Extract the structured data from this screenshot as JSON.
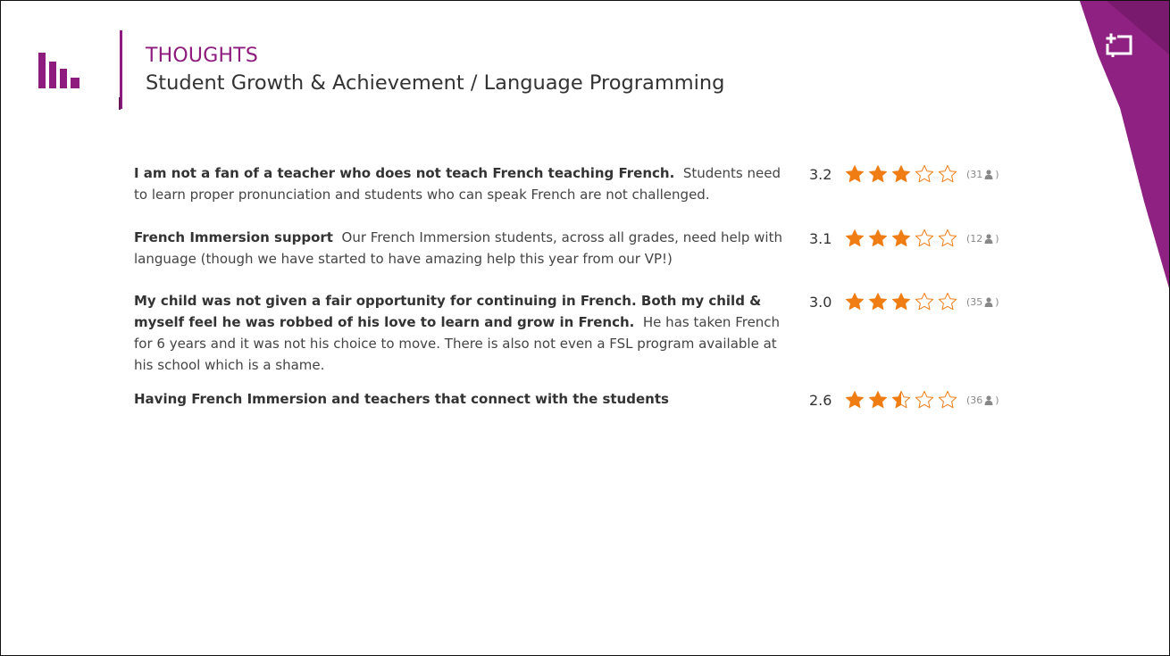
{
  "header": {
    "title": "THOUGHTS",
    "subtitle": "Student Growth & Achievement / Language Programming"
  },
  "colors": {
    "brand": "#8e1b7e",
    "star_filled": "#f07c14",
    "star_empty": "#f07c14"
  },
  "icons": {
    "logo": "bar-chart-logo-icon",
    "corner": "expand-frame-icon",
    "count": "person-icon"
  },
  "items": [
    {
      "bold": "I am not a fan of a teacher who does not teach French teaching French.",
      "body": "Students need to learn proper pronunciation and students who can speak French are not challenged.",
      "score": "3.2",
      "stars": 3.2,
      "count": "31"
    },
    {
      "bold": "French Immersion support",
      "body": "Our French Immersion students, across all grades, need help with language (though we have started to have amazing help this year from our VP!)",
      "score": "3.1",
      "stars": 3.1,
      "count": "12"
    },
    {
      "bold": "My child was not given a fair opportunity for continuing in French. Both my child & myself feel he was robbed of his love to learn and grow in French.",
      "body": "He has taken French for 6 years and it was not his choice to move. There is also not even a FSL program available at his school which is a shame.",
      "score": "3.0",
      "stars": 3.0,
      "count": "35"
    },
    {
      "bold": "Having French Immersion and teachers that connect with the students",
      "body": "",
      "score": "2.6",
      "stars": 2.6,
      "count": "36"
    }
  ]
}
